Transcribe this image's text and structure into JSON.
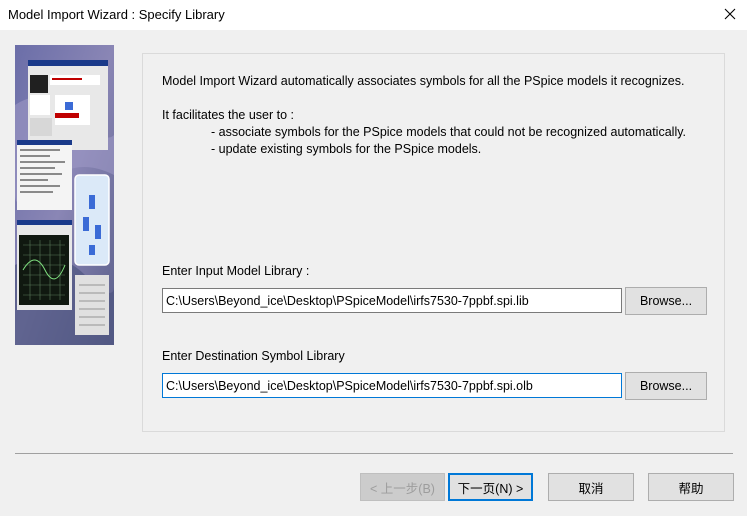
{
  "window": {
    "title": "Model Import Wizard : Specify Library",
    "close_icon": "close-icon"
  },
  "intro": {
    "line1": "Model Import Wizard automatically associates symbols for all the PSpice models it recognizes.",
    "line2": "It facilitates the user to :",
    "bullet1": "- associate symbols for the PSpice models that could not be recognized automatically.",
    "bullet2": "- update existing symbols for the PSpice models."
  },
  "input_library": {
    "label": "Enter Input Model Library :",
    "value": "C:\\Users\\Beyond_ice\\Desktop\\PSpiceModel\\irfs7530-7ppbf.spi.lib",
    "browse_label": "Browse..."
  },
  "destination_library": {
    "label": "Enter Destination Symbol Library",
    "value": "C:\\Users\\Beyond_ice\\Desktop\\PSpiceModel\\irfs7530-7ppbf.spi.olb",
    "browse_label": "Browse..."
  },
  "footer": {
    "back_label": "< 上一步(B)",
    "next_label": "下一页(N) >",
    "cancel_label": "取消",
    "help_label": "帮助"
  },
  "colors": {
    "accent": "#0078d7",
    "background": "#f0f0f0"
  }
}
